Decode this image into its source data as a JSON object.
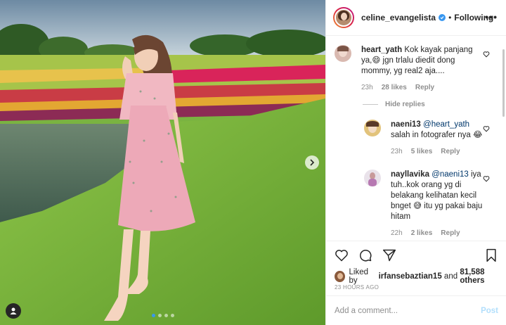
{
  "post": {
    "carousel": {
      "slide_count": 4,
      "active_slide": 1
    },
    "icons": {
      "next": "chevron-right-icon",
      "tag": "user-tag-icon"
    }
  },
  "header": {
    "username": "celine_evangelista",
    "separator": "•",
    "follow_state": "Following",
    "more": "•••"
  },
  "comments": [
    {
      "username": "heart_yath",
      "text": "Kok kayak panjang ya,😄 jgn trlalu diedit dong mommy, yg real2 aja....",
      "time": "23h",
      "likes": "28 likes",
      "reply": "Reply"
    },
    {
      "username": "naeni13",
      "mention": "@heart_yath",
      "text": "salah in fotografer nya 😂",
      "time": "23h",
      "likes": "5 likes",
      "reply": "Reply"
    },
    {
      "username": "nayllavika",
      "mention": "@naeni13",
      "text": "iya tuh..kok orang yg di belakang kelihatan kecil bnget 😅 itu yg pakai baju hitam",
      "time": "22h",
      "likes": "2 likes",
      "reply": "Reply"
    }
  ],
  "hide_replies": "Hide replies",
  "likes": {
    "prefix": "Liked by",
    "user": "irfansebaztian15",
    "conj": "and",
    "others": "81,588 others"
  },
  "time_ago": "23 HOURS AGO",
  "add_comment": {
    "placeholder": "Add a comment...",
    "post_label": "Post"
  },
  "colors": {
    "accent": "#3897f0",
    "post_disabled": "#b2dffc",
    "muted": "#8e8e8e"
  }
}
